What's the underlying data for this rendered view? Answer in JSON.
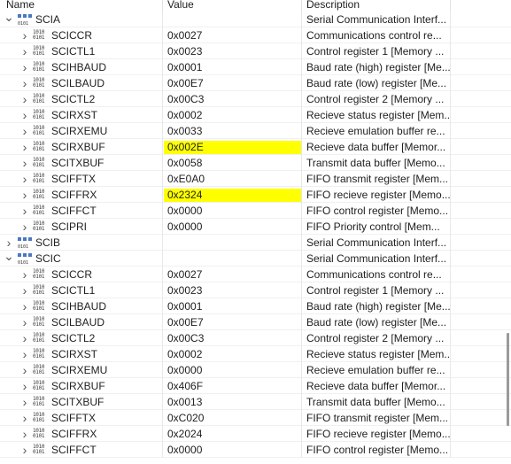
{
  "columns": {
    "name": "Name",
    "value": "Value",
    "description": "Description"
  },
  "icons": {
    "register": "register-binary-icon",
    "group": "peripheral-group-icon",
    "expanded": "chevron-down-icon",
    "collapsed": "chevron-right-icon"
  },
  "highlight_color": "#ffff00",
  "rows": [
    {
      "kind": "group",
      "expanded": true,
      "name": "SCIA",
      "value": "",
      "description": "Serial Communication Interf..."
    },
    {
      "kind": "reg",
      "name": "SCICCR",
      "value": "0x0027",
      "description": "Communications control re..."
    },
    {
      "kind": "reg",
      "name": "SCICTL1",
      "value": "0x0023",
      "description": "Control register 1 [Memory ..."
    },
    {
      "kind": "reg",
      "name": "SCIHBAUD",
      "value": "0x0001",
      "description": "Baud rate (high) register [Me..."
    },
    {
      "kind": "reg",
      "name": "SCILBAUD",
      "value": "0x00E7",
      "description": "Baud rate (low) register [Me..."
    },
    {
      "kind": "reg",
      "name": "SCICTL2",
      "value": "0x00C3",
      "description": "Control register 2 [Memory ..."
    },
    {
      "kind": "reg",
      "name": "SCIRXST",
      "value": "0x0002",
      "description": "Recieve status register [Mem..."
    },
    {
      "kind": "reg",
      "name": "SCIRXEMU",
      "value": "0x0033",
      "description": "Recieve emulation buffer re..."
    },
    {
      "kind": "reg",
      "name": "SCIRXBUF",
      "value": "0x002E",
      "description": "Recieve data buffer [Memor...",
      "highlight": true
    },
    {
      "kind": "reg",
      "name": "SCITXBUF",
      "value": "0x0058",
      "description": "Transmit data buffer [Memo..."
    },
    {
      "kind": "reg",
      "name": "SCIFFTX",
      "value": "0xE0A0",
      "description": "FIFO transmit register [Mem..."
    },
    {
      "kind": "reg",
      "name": "SCIFFRX",
      "value": "0x2324",
      "description": "FIFO recieve register [Memo...",
      "highlight": true
    },
    {
      "kind": "reg",
      "name": "SCIFFCT",
      "value": "0x0000",
      "description": "FIFO control register [Memo..."
    },
    {
      "kind": "reg",
      "name": "SCIPRI",
      "value": "0x0000",
      "description": "FIFO Priority control [Mem..."
    },
    {
      "kind": "group",
      "expanded": false,
      "name": "SCIB",
      "value": "",
      "description": "Serial Communication Interf..."
    },
    {
      "kind": "group",
      "expanded": true,
      "name": "SCIC",
      "value": "",
      "description": "Serial Communication Interf..."
    },
    {
      "kind": "reg",
      "name": "SCICCR",
      "value": "0x0027",
      "description": "Communications control re..."
    },
    {
      "kind": "reg",
      "name": "SCICTL1",
      "value": "0x0023",
      "description": "Control register 1 [Memory ..."
    },
    {
      "kind": "reg",
      "name": "SCIHBAUD",
      "value": "0x0001",
      "description": "Baud rate (high) register [Me..."
    },
    {
      "kind": "reg",
      "name": "SCILBAUD",
      "value": "0x00E7",
      "description": "Baud rate (low) register [Me..."
    },
    {
      "kind": "reg",
      "name": "SCICTL2",
      "value": "0x00C3",
      "description": "Control register 2 [Memory ..."
    },
    {
      "kind": "reg",
      "name": "SCIRXST",
      "value": "0x0002",
      "description": "Recieve status register [Mem..."
    },
    {
      "kind": "reg",
      "name": "SCIRXEMU",
      "value": "0x0000",
      "description": "Recieve emulation buffer re..."
    },
    {
      "kind": "reg",
      "name": "SCIRXBUF",
      "value": "0x406F",
      "description": "Recieve data buffer [Memor..."
    },
    {
      "kind": "reg",
      "name": "SCITXBUF",
      "value": "0x0013",
      "description": "Transmit data buffer [Memo..."
    },
    {
      "kind": "reg",
      "name": "SCIFFTX",
      "value": "0xC020",
      "description": "FIFO transmit register [Mem..."
    },
    {
      "kind": "reg",
      "name": "SCIFFRX",
      "value": "0x2024",
      "description": "FIFO recieve register [Memo..."
    },
    {
      "kind": "reg",
      "name": "SCIFFCT",
      "value": "0x0000",
      "description": "FIFO control register [Memo..."
    }
  ]
}
